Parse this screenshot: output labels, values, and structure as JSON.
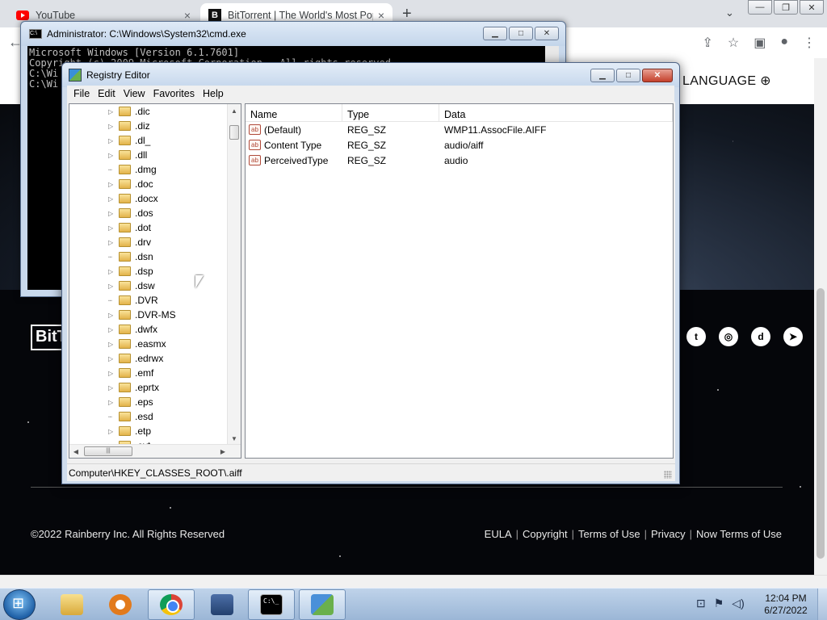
{
  "browser": {
    "tabs": [
      {
        "title": "YouTube"
      },
      {
        "title": "BitTorrent | The World's Most Pop"
      }
    ],
    "new_tab": "+",
    "tab_close": "×",
    "back": "←",
    "toolbar_icons": [
      "share-icon",
      "star-icon",
      "sidebar-icon",
      "profile-icon",
      "menu-icon"
    ]
  },
  "page": {
    "language_link": "LANGUAGE",
    "logo_text": "BitT",
    "copyright": "©2022 Rainberry Inc. All Rights Reserved",
    "footer_links": [
      "EULA",
      "Copyright",
      "Terms of Use",
      "Privacy",
      "Now Terms of Use"
    ],
    "social_icons": [
      "twitter-icon",
      "instagram-icon",
      "discord-icon",
      "telegram-icon"
    ]
  },
  "cmd": {
    "title": "Administrator: C:\\Windows\\System32\\cmd.exe",
    "lines": [
      "Microsoft Windows [Version 6.1.7601]",
      "Copyright (c) 2009 Microsoft Corporation.  All rights reserved.",
      "",
      "C:\\Wi",
      "",
      "C:\\Wi"
    ]
  },
  "regedit": {
    "title": "Registry Editor",
    "menu": [
      "File",
      "Edit",
      "View",
      "Favorites",
      "Help"
    ],
    "tree": [
      {
        "name": ".dic",
        "expandable": true
      },
      {
        "name": ".diz",
        "expandable": true
      },
      {
        "name": ".dl_",
        "expandable": true
      },
      {
        "name": ".dll",
        "expandable": true
      },
      {
        "name": ".dmg",
        "expandable": false
      },
      {
        "name": ".doc",
        "expandable": true
      },
      {
        "name": ".docx",
        "expandable": true
      },
      {
        "name": ".dos",
        "expandable": true
      },
      {
        "name": ".dot",
        "expandable": true
      },
      {
        "name": ".drv",
        "expandable": true
      },
      {
        "name": ".dsn",
        "expandable": false
      },
      {
        "name": ".dsp",
        "expandable": true
      },
      {
        "name": ".dsw",
        "expandable": true
      },
      {
        "name": ".DVR",
        "expandable": false
      },
      {
        "name": ".DVR-MS",
        "expandable": true
      },
      {
        "name": ".dwfx",
        "expandable": true
      },
      {
        "name": ".easmx",
        "expandable": true
      },
      {
        "name": ".edrwx",
        "expandable": true
      },
      {
        "name": ".emf",
        "expandable": true
      },
      {
        "name": ".eprtx",
        "expandable": true
      },
      {
        "name": ".eps",
        "expandable": true
      },
      {
        "name": ".esd",
        "expandable": false
      },
      {
        "name": ".etp",
        "expandable": true
      },
      {
        "name": ".evt",
        "expandable": true
      }
    ],
    "columns": {
      "name": "Name",
      "type": "Type",
      "data": "Data"
    },
    "values": [
      {
        "name": "(Default)",
        "type": "REG_SZ",
        "data": "WMP11.AssocFile.AIFF"
      },
      {
        "name": "Content Type",
        "type": "REG_SZ",
        "data": "audio/aiff"
      },
      {
        "name": "PerceivedType",
        "type": "REG_SZ",
        "data": "audio"
      }
    ],
    "status_path": "Computer\\HKEY_CLASSES_ROOT\\.aiff"
  },
  "taskbar": {
    "clock_time": "12:04 PM",
    "clock_date": "6/27/2022",
    "cmd_glyph": "C:\\_"
  }
}
